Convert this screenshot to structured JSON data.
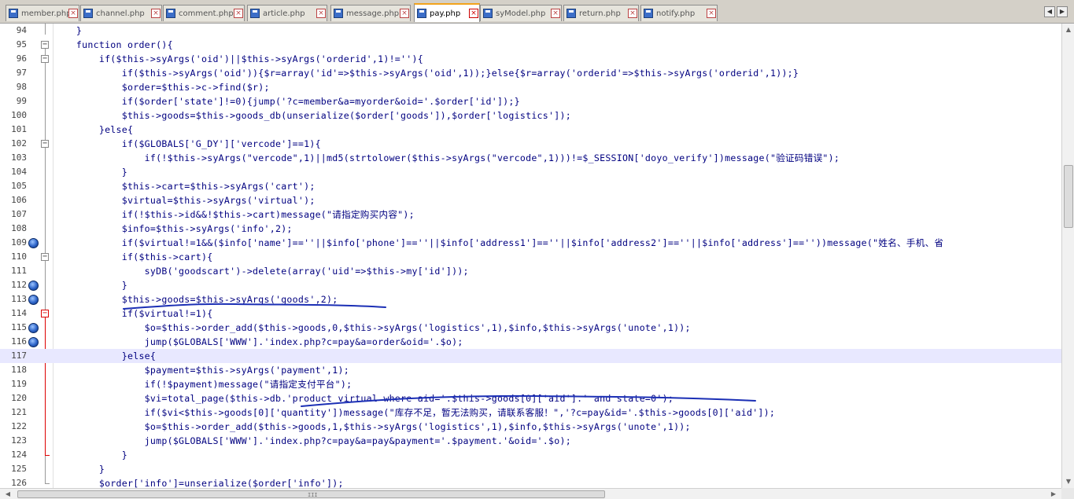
{
  "tabs": [
    {
      "label": "member.php",
      "active": false
    },
    {
      "label": "channel.php",
      "active": false
    },
    {
      "label": "comment.php",
      "active": false
    },
    {
      "label": "article.php",
      "active": false
    },
    {
      "label": "message.php",
      "active": false
    },
    {
      "label": "pay.php",
      "active": true
    },
    {
      "label": "syModel.php",
      "active": false
    },
    {
      "label": "return.php",
      "active": false
    },
    {
      "label": "notify.php",
      "active": false
    }
  ],
  "nav": {
    "left_icon": "arrow-left-icon",
    "right_icon": "arrow-right-icon"
  },
  "colors": {
    "accent_tab": "#f2a31c",
    "bookmark": "#2d64c8",
    "annotation_ink": "#1b2fb5",
    "fold_active": "#d00000"
  },
  "lines": [
    {
      "num": "94",
      "text": "    }"
    },
    {
      "num": "95",
      "text": "    function order(){"
    },
    {
      "num": "96",
      "text": "        if($this->syArgs('oid')||$this->syArgs('orderid',1)!=''){"
    },
    {
      "num": "97",
      "text": "            if($this->syArgs('oid')){$r=array('id'=>$this->syArgs('oid',1));}else{$r=array('orderid'=>$this->syArgs('orderid',1));}"
    },
    {
      "num": "98",
      "text": "            $order=$this->c->find($r);"
    },
    {
      "num": "99",
      "text": "            if($order['state']!=0){jump('?c=member&a=myorder&oid='.$order['id']);}"
    },
    {
      "num": "100",
      "text": "            $this->goods=$this->goods_db(unserialize($order['goods']),$order['logistics']);"
    },
    {
      "num": "101",
      "text": "        }else{"
    },
    {
      "num": "102",
      "text": "            if($GLOBALS['G_DY']['vercode']==1){"
    },
    {
      "num": "103",
      "text": "                if(!$this->syArgs(\"vercode\",1)||md5(strtolower($this->syArgs(\"vercode\",1)))!=$_SESSION['doyo_verify'])message(\"验证码错误\");"
    },
    {
      "num": "104",
      "text": "            }"
    },
    {
      "num": "105",
      "text": "            $this->cart=$this->syArgs('cart');"
    },
    {
      "num": "106",
      "text": "            $virtual=$this->syArgs('virtual');"
    },
    {
      "num": "107",
      "text": "            if(!$this->id&&!$this->cart)message(\"请指定购买内容\");"
    },
    {
      "num": "108",
      "text": "            $info=$this->syArgs('info',2);"
    },
    {
      "num": "109",
      "text": "            if($virtual!=1&&($info['name']==''||$info['phone']==''||$info['address1']==''||$info['address2']==''||$info['address']==''))message(\"姓名、手机、省"
    },
    {
      "num": "110",
      "text": "            if($this->cart){"
    },
    {
      "num": "111",
      "text": "                syDB('goodscart')->delete(array('uid'=>$this->my['id']));"
    },
    {
      "num": "112",
      "text": "            }"
    },
    {
      "num": "113",
      "text": "            $this->goods=$this->syArgs('goods',2);"
    },
    {
      "num": "114",
      "text": "            if($virtual!=1){"
    },
    {
      "num": "115",
      "text": "                $o=$this->order_add($this->goods,0,$this->syArgs('logistics',1),$info,$this->syArgs('unote',1));"
    },
    {
      "num": "116",
      "text": "                jump($GLOBALS['WWW'].'index.php?c=pay&a=order&oid='.$o);"
    },
    {
      "num": "117",
      "text": "            }else{"
    },
    {
      "num": "118",
      "text": "                $payment=$this->syArgs('payment',1);"
    },
    {
      "num": "119",
      "text": "                if(!$payment)message(\"请指定支付平台\");"
    },
    {
      "num": "120",
      "text": "                $vi=total_page($this->db.'product_virtual where aid='.$this->goods[0]['aid'].' and state=0');"
    },
    {
      "num": "121",
      "text": "                if($vi<$this->goods[0]['quantity'])message(\"库存不足，暂无法购买，请联系客服！\",'?c=pay&id='.$this->goods[0]['aid']);"
    },
    {
      "num": "122",
      "text": "                $o=$this->order_add($this->goods,1,$this->syArgs('logistics',1),$info,$this->syArgs('unote',1));"
    },
    {
      "num": "123",
      "text": "                jump($GLOBALS['WWW'].'index.php?c=pay&a=pay&payment='.$payment.'&oid='.$o);"
    },
    {
      "num": "124",
      "text": "            }"
    },
    {
      "num": "125",
      "text": "        }"
    },
    {
      "num": "126",
      "text": "        $order['info']=unserialize($order['info']);"
    }
  ],
  "scrollbar": {
    "v_up_icon": "up-arrow-icon",
    "v_down_icon": "down-arrow-icon",
    "h_left_icon": "left-arrow-icon",
    "h_right_icon": "right-arrow-icon",
    "h_grip": "III"
  }
}
